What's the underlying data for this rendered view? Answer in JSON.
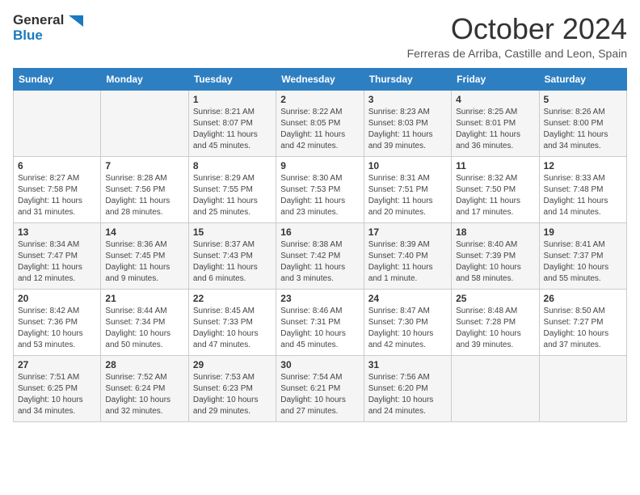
{
  "header": {
    "logo_line1": "General",
    "logo_line2": "Blue",
    "month": "October 2024",
    "location": "Ferreras de Arriba, Castille and Leon, Spain"
  },
  "days_of_week": [
    "Sunday",
    "Monday",
    "Tuesday",
    "Wednesday",
    "Thursday",
    "Friday",
    "Saturday"
  ],
  "weeks": [
    [
      {
        "day": "",
        "info": ""
      },
      {
        "day": "",
        "info": ""
      },
      {
        "day": "1",
        "info": "Sunrise: 8:21 AM\nSunset: 8:07 PM\nDaylight: 11 hours and 45 minutes."
      },
      {
        "day": "2",
        "info": "Sunrise: 8:22 AM\nSunset: 8:05 PM\nDaylight: 11 hours and 42 minutes."
      },
      {
        "day": "3",
        "info": "Sunrise: 8:23 AM\nSunset: 8:03 PM\nDaylight: 11 hours and 39 minutes."
      },
      {
        "day": "4",
        "info": "Sunrise: 8:25 AM\nSunset: 8:01 PM\nDaylight: 11 hours and 36 minutes."
      },
      {
        "day": "5",
        "info": "Sunrise: 8:26 AM\nSunset: 8:00 PM\nDaylight: 11 hours and 34 minutes."
      }
    ],
    [
      {
        "day": "6",
        "info": "Sunrise: 8:27 AM\nSunset: 7:58 PM\nDaylight: 11 hours and 31 minutes."
      },
      {
        "day": "7",
        "info": "Sunrise: 8:28 AM\nSunset: 7:56 PM\nDaylight: 11 hours and 28 minutes."
      },
      {
        "day": "8",
        "info": "Sunrise: 8:29 AM\nSunset: 7:55 PM\nDaylight: 11 hours and 25 minutes."
      },
      {
        "day": "9",
        "info": "Sunrise: 8:30 AM\nSunset: 7:53 PM\nDaylight: 11 hours and 23 minutes."
      },
      {
        "day": "10",
        "info": "Sunrise: 8:31 AM\nSunset: 7:51 PM\nDaylight: 11 hours and 20 minutes."
      },
      {
        "day": "11",
        "info": "Sunrise: 8:32 AM\nSunset: 7:50 PM\nDaylight: 11 hours and 17 minutes."
      },
      {
        "day": "12",
        "info": "Sunrise: 8:33 AM\nSunset: 7:48 PM\nDaylight: 11 hours and 14 minutes."
      }
    ],
    [
      {
        "day": "13",
        "info": "Sunrise: 8:34 AM\nSunset: 7:47 PM\nDaylight: 11 hours and 12 minutes."
      },
      {
        "day": "14",
        "info": "Sunrise: 8:36 AM\nSunset: 7:45 PM\nDaylight: 11 hours and 9 minutes."
      },
      {
        "day": "15",
        "info": "Sunrise: 8:37 AM\nSunset: 7:43 PM\nDaylight: 11 hours and 6 minutes."
      },
      {
        "day": "16",
        "info": "Sunrise: 8:38 AM\nSunset: 7:42 PM\nDaylight: 11 hours and 3 minutes."
      },
      {
        "day": "17",
        "info": "Sunrise: 8:39 AM\nSunset: 7:40 PM\nDaylight: 11 hours and 1 minute."
      },
      {
        "day": "18",
        "info": "Sunrise: 8:40 AM\nSunset: 7:39 PM\nDaylight: 10 hours and 58 minutes."
      },
      {
        "day": "19",
        "info": "Sunrise: 8:41 AM\nSunset: 7:37 PM\nDaylight: 10 hours and 55 minutes."
      }
    ],
    [
      {
        "day": "20",
        "info": "Sunrise: 8:42 AM\nSunset: 7:36 PM\nDaylight: 10 hours and 53 minutes."
      },
      {
        "day": "21",
        "info": "Sunrise: 8:44 AM\nSunset: 7:34 PM\nDaylight: 10 hours and 50 minutes."
      },
      {
        "day": "22",
        "info": "Sunrise: 8:45 AM\nSunset: 7:33 PM\nDaylight: 10 hours and 47 minutes."
      },
      {
        "day": "23",
        "info": "Sunrise: 8:46 AM\nSunset: 7:31 PM\nDaylight: 10 hours and 45 minutes."
      },
      {
        "day": "24",
        "info": "Sunrise: 8:47 AM\nSunset: 7:30 PM\nDaylight: 10 hours and 42 minutes."
      },
      {
        "day": "25",
        "info": "Sunrise: 8:48 AM\nSunset: 7:28 PM\nDaylight: 10 hours and 39 minutes."
      },
      {
        "day": "26",
        "info": "Sunrise: 8:50 AM\nSunset: 7:27 PM\nDaylight: 10 hours and 37 minutes."
      }
    ],
    [
      {
        "day": "27",
        "info": "Sunrise: 7:51 AM\nSunset: 6:25 PM\nDaylight: 10 hours and 34 minutes."
      },
      {
        "day": "28",
        "info": "Sunrise: 7:52 AM\nSunset: 6:24 PM\nDaylight: 10 hours and 32 minutes."
      },
      {
        "day": "29",
        "info": "Sunrise: 7:53 AM\nSunset: 6:23 PM\nDaylight: 10 hours and 29 minutes."
      },
      {
        "day": "30",
        "info": "Sunrise: 7:54 AM\nSunset: 6:21 PM\nDaylight: 10 hours and 27 minutes."
      },
      {
        "day": "31",
        "info": "Sunrise: 7:56 AM\nSunset: 6:20 PM\nDaylight: 10 hours and 24 minutes."
      },
      {
        "day": "",
        "info": ""
      },
      {
        "day": "",
        "info": ""
      }
    ]
  ]
}
